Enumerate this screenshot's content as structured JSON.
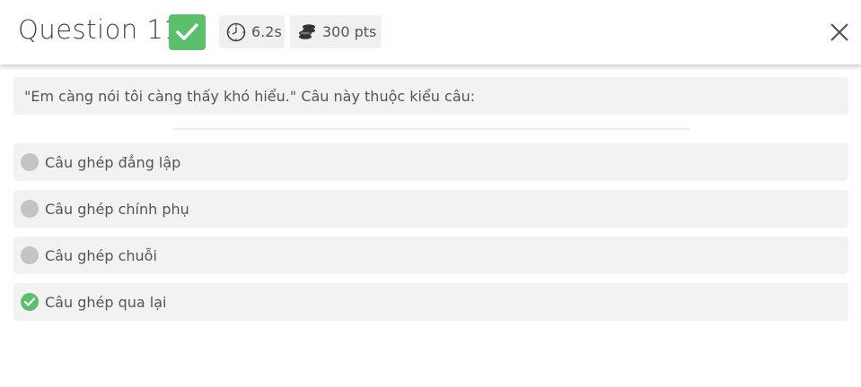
{
  "header": {
    "title": "Question 11",
    "time": "6.2s",
    "points": "300 pts",
    "result_icon": "check-icon",
    "colors": {
      "correct": "#5cbf6b",
      "chip_bg": "#f0f0f0"
    }
  },
  "question": {
    "text": "\"Em càng nói tôi càng thấy khó hiểu.\" Câu này thuộc kiểu câu:"
  },
  "options": [
    {
      "label": "Câu ghép đẳng lập",
      "state": "neutral"
    },
    {
      "label": "Câu ghép chính phụ",
      "state": "neutral"
    },
    {
      "label": "Câu ghép chuỗi",
      "state": "neutral"
    },
    {
      "label": "Câu ghép qua lại",
      "state": "correct"
    }
  ]
}
